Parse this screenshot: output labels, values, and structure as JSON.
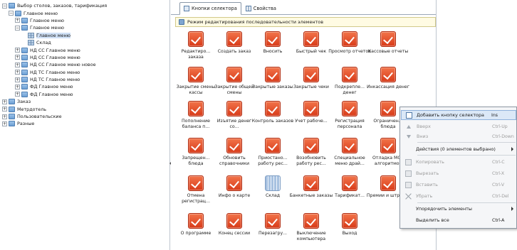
{
  "tree": [
    {
      "label": "Выбор столов, заказов, тарификация",
      "toggle": "−",
      "icon": "folder-icon",
      "depth": 0
    },
    {
      "label": "Главное меню",
      "toggle": "−",
      "icon": "folder-icon",
      "depth": 1
    },
    {
      "label": "Главное меню",
      "toggle": "+",
      "icon": "folder-icon",
      "depth": 2
    },
    {
      "label": "Главное меню",
      "toggle": "−",
      "icon": "folder-icon",
      "depth": 2
    },
    {
      "label": "Главное меню",
      "toggle": "",
      "icon": "grid-icon",
      "depth": 3,
      "selected": true
    },
    {
      "label": "Склад",
      "toggle": "",
      "icon": "grid-icon",
      "depth": 3
    },
    {
      "label": "НД СС Главное меню",
      "toggle": "+",
      "icon": "folder-icon",
      "depth": 2
    },
    {
      "label": "НД СС Главное меню",
      "toggle": "+",
      "icon": "folder-icon",
      "depth": 2
    },
    {
      "label": "НД СС Главное меню новое",
      "toggle": "+",
      "icon": "folder-icon",
      "depth": 2
    },
    {
      "label": "НД ТС Главное меню",
      "toggle": "+",
      "icon": "folder-icon",
      "depth": 2
    },
    {
      "label": "НД ТС Главное меню",
      "toggle": "+",
      "icon": "folder-icon",
      "depth": 2
    },
    {
      "label": "ФД Главное меню",
      "toggle": "+",
      "icon": "folder-icon",
      "depth": 2
    },
    {
      "label": "ФД Главное меню",
      "toggle": "+",
      "icon": "folder-icon",
      "depth": 2
    },
    {
      "label": "Заказ",
      "toggle": "+",
      "icon": "folder-icon",
      "depth": 0
    },
    {
      "label": "Метрдотель",
      "toggle": "+",
      "icon": "folder-icon",
      "depth": 0
    },
    {
      "label": "Пользовательские",
      "toggle": "+",
      "icon": "folder-icon",
      "depth": 0
    },
    {
      "label": "Разные",
      "toggle": "+",
      "icon": "folder-icon",
      "depth": 0
    }
  ],
  "tabs": [
    {
      "label": "Кнопки селектора",
      "active": true
    },
    {
      "label": "Свойства",
      "active": false
    }
  ],
  "mode_bar": "Режим редактирования последовательности элементов",
  "buttons": [
    [
      "Редактиро... заказа",
      "Создать заказ",
      "Вносить",
      "Быстрый чек",
      "Просмотр отчетов",
      "Кассовые отчеты"
    ],
    [
      "Закрытие смены кассы",
      "Закрытие общей смены",
      "Закрытые заказы",
      "Закрытые чеки",
      "Подкрепле... денег",
      "Инкассация денег"
    ],
    [
      "Пополнение баланса п...",
      "Изъятие денег со...",
      "Контроль заказов",
      "Учет рабоче...",
      "Регистрация персонала",
      "Ограничен... блюда"
    ],
    [
      "Запрещен... блюда",
      "Обновить справочники",
      "Приостано... работу рес...",
      "Возобновить работу рес...",
      "Специальное меню драй...",
      "Отладка MCR алгоритмов"
    ],
    [
      "Отмена регистрац...",
      "Инфо о карте",
      "Склад",
      "Банкетные заказы",
      "Тарификат...",
      "Премии и штрафы"
    ],
    [
      "О программе",
      "Конец сессии",
      "Перезагру...",
      "Выключение компьютера",
      "Выход"
    ]
  ],
  "stock_button": "Склад",
  "context_menu": [
    {
      "label": "Добавить кнопку селектора",
      "shortcut": "Ins",
      "highlighted": true
    },
    {
      "label": "Вверх",
      "shortcut": "Ctrl-Up",
      "disabled": true
    },
    {
      "label": "Вниз",
      "shortcut": "Ctrl-Down",
      "disabled": true
    },
    {
      "label": "Действия (0 элементов выбрано)",
      "submenu": true
    },
    {
      "label": "Копировать",
      "shortcut": "Ctrl-C",
      "disabled": true
    },
    {
      "label": "Вырезать",
      "shortcut": "Ctrl-X",
      "disabled": true
    },
    {
      "label": "Вставить",
      "shortcut": "Ctrl-V",
      "disabled": true
    },
    {
      "label": "Убрать",
      "shortcut": "Ctrl-Del",
      "disabled": true
    },
    {
      "label": "Упорядочить элементы",
      "submenu": true
    },
    {
      "label": "Выделить все",
      "shortcut": "Ctrl-A"
    }
  ]
}
